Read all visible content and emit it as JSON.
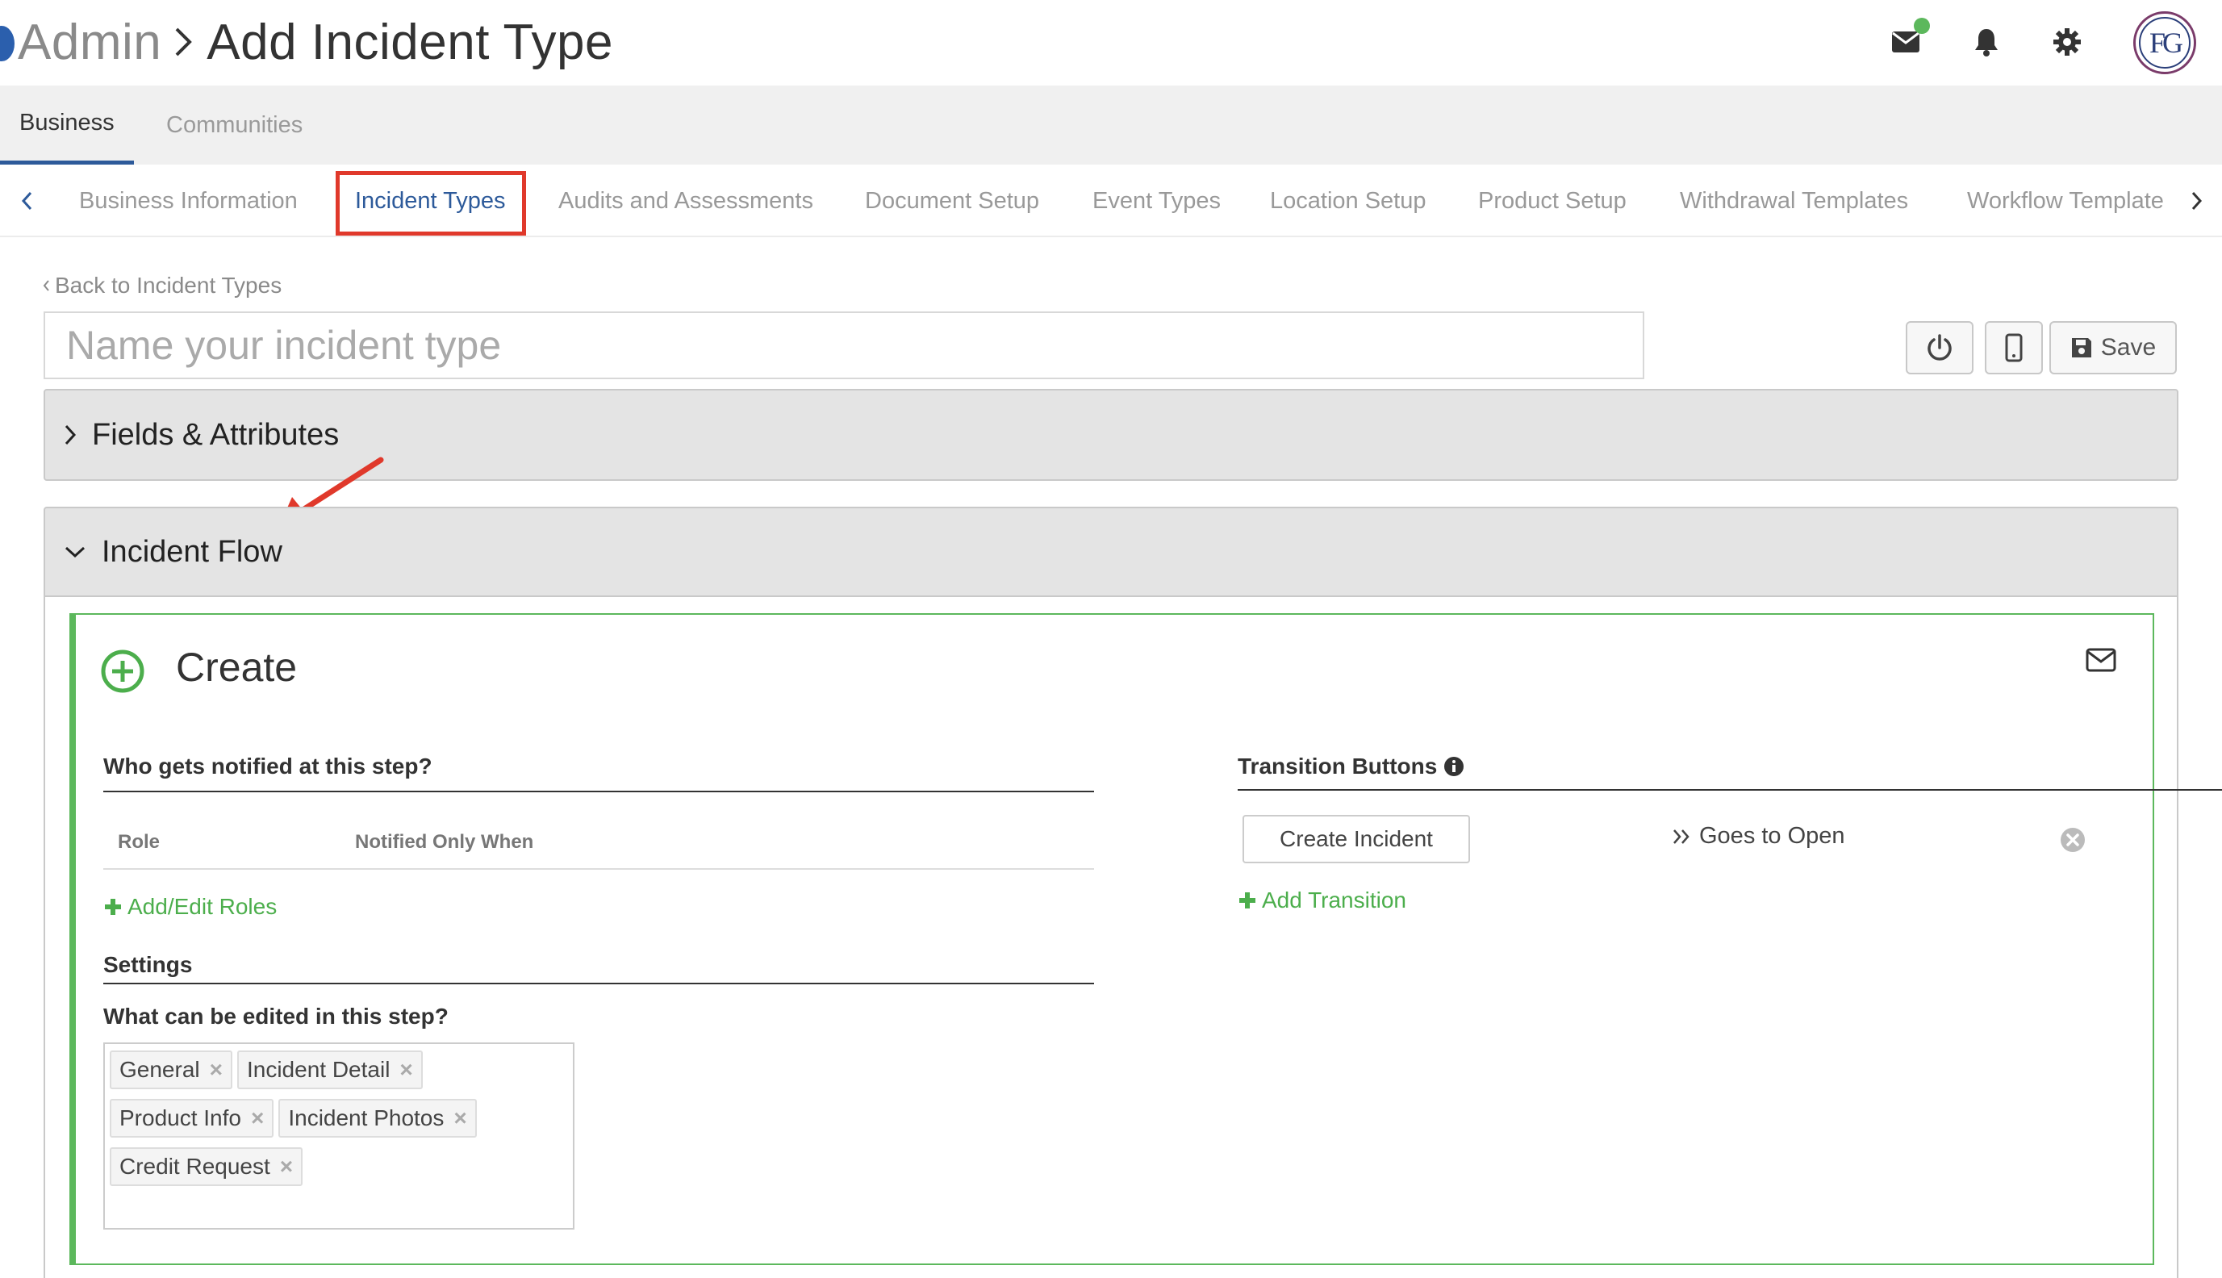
{
  "header": {
    "breadcrumb_root": "Admin",
    "breadcrumb_current": "Add Incident Type",
    "avatar_initials": "FG",
    "icons": [
      "mail-icon",
      "bell-icon",
      "gear-icon"
    ]
  },
  "primary_tabs": [
    {
      "label": "Business",
      "active": true
    },
    {
      "label": "Communities",
      "active": false
    }
  ],
  "secondary_tabs": [
    {
      "label": "Business Information"
    },
    {
      "label": "Incident Types",
      "active": true
    },
    {
      "label": "Audits and Assessments"
    },
    {
      "label": "Document Setup"
    },
    {
      "label": "Event Types"
    },
    {
      "label": "Location Setup"
    },
    {
      "label": "Product Setup"
    },
    {
      "label": "Withdrawal Templates"
    },
    {
      "label": "Workflow Template"
    }
  ],
  "content": {
    "back_link": "Back to Incident Types",
    "name_input": {
      "value": "",
      "placeholder": "Name your incident type"
    },
    "save_label": "Save"
  },
  "accordions": {
    "fields": {
      "title": "Fields & Attributes",
      "expanded": false
    },
    "flow": {
      "title": "Incident Flow",
      "expanded": true
    }
  },
  "step": {
    "title": "Create",
    "notified_heading": "Who gets notified at this step?",
    "columns": {
      "role": "Role",
      "when": "Notified Only When"
    },
    "add_roles": "Add/Edit Roles",
    "settings_heading": "Settings",
    "editable_heading": "What can be edited in this step?",
    "editable_tags": [
      "General",
      "Incident Detail",
      "Product Info",
      "Incident Photos",
      "Credit Request"
    ],
    "transitions_heading": "Transition Buttons",
    "transition": {
      "button": "Create Incident",
      "goes_to": "Goes to Open"
    },
    "add_transition": "Add Transition"
  },
  "colors": {
    "accent_blue": "#2d5a9a",
    "success_green": "#5cb85c",
    "highlight_red": "#e0392b"
  }
}
